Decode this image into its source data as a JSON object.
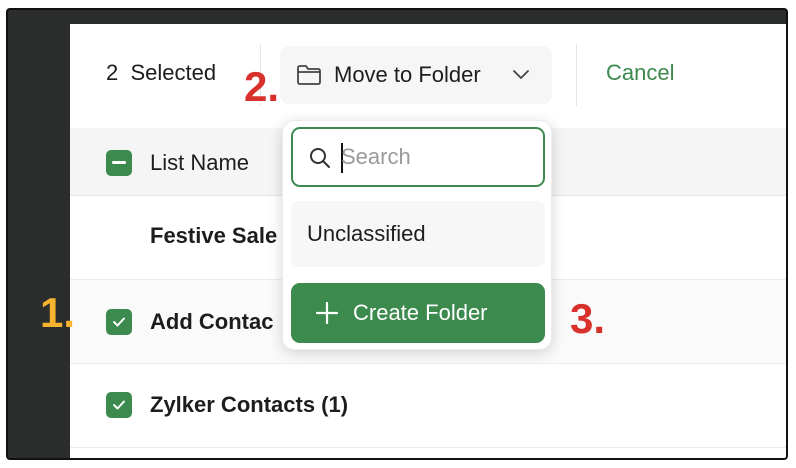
{
  "toolbar": {
    "selected_count": "2",
    "selected_label": "Selected",
    "move_label": "Move to Folder",
    "cancel_label": "Cancel"
  },
  "table": {
    "header": "List Name",
    "rows": [
      {
        "name": "Festive Sale",
        "checked": false
      },
      {
        "name": "Add Contac",
        "checked": true
      },
      {
        "name": "Zylker Contacts (1)",
        "checked": true
      }
    ]
  },
  "dropdown": {
    "search_placeholder": "Search",
    "options": [
      "Unclassified"
    ],
    "create_label": "Create Folder"
  },
  "annotations": [
    "1.",
    "2.",
    "3."
  ],
  "colors": {
    "accent": "#3d8a4e",
    "annotation_orange": "#f5b32e",
    "annotation_red": "#d8302b"
  },
  "icons": [
    "folder-icon",
    "chevron-down-icon",
    "minus-icon",
    "check-icon",
    "search-icon",
    "plus-icon"
  ]
}
